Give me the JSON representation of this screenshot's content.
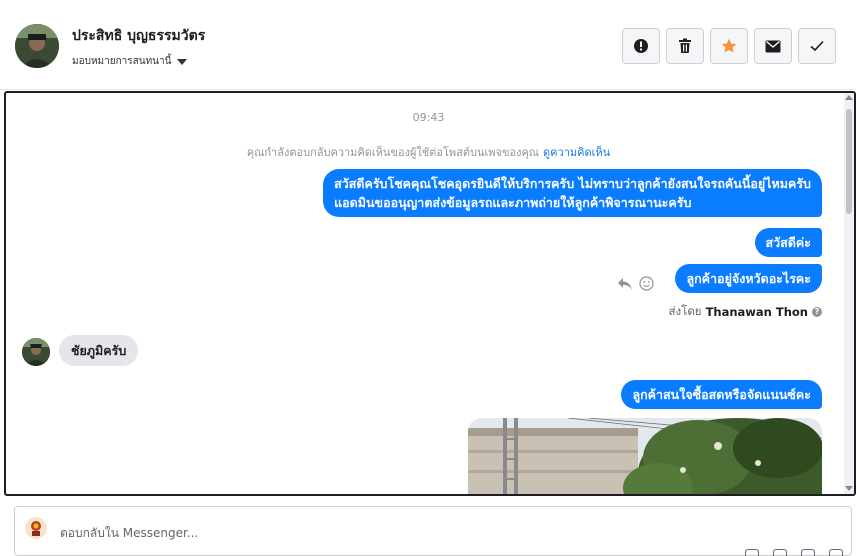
{
  "header": {
    "contact_name": "ประสิทธิ บุญธรรมวัตร",
    "assign_label": "มอบหมายการสนทนานี้",
    "actions": [
      {
        "icon": "alert-icon",
        "name": "spam-button"
      },
      {
        "icon": "trash-icon",
        "name": "delete-button"
      },
      {
        "icon": "star-icon",
        "name": "star-button",
        "color": "#f7923b"
      },
      {
        "icon": "envelope-icon",
        "name": "mark-unread-button"
      },
      {
        "icon": "checkmark-icon",
        "name": "mark-done-button"
      }
    ]
  },
  "conversation": {
    "time": "09:43",
    "notice": "คุณกำลังตอบกลับความคิดเห็นของผู้ใช้ต่อโพสต์บนเพจของคุณ",
    "notice_link": "ดูความคิดเห็น",
    "outgoing_1_line1": "สวัสดีครับโชคคุณโชคอุดรยินดีให้บริการครับ ไม่ทราบว่าลูกค้ายังสนใจรถคันนี้อยู่ไหมครับ",
    "outgoing_1_line2": "แอดมินขออนุญาตส่งข้อมูลรถและภาพถ่ายให้ลูกค้าพิจารณานะครับ",
    "outgoing_2": "สวัสดีค่ะ",
    "outgoing_3": "ลูกค้าอยู่จังหวัดอะไรคะ",
    "sent_by_label": "ส่งโดย",
    "sent_by_name": "Thanawan Thon",
    "incoming_1": "ชัยภูมิครับ",
    "outgoing_4": "ลูกค้าสนใจซื้อสดหรือจัดแนนซ์คะ"
  },
  "reply": {
    "placeholder": "ตอบกลับใน Messenger..."
  },
  "colors": {
    "bubble_out": "#0a7cff",
    "bubble_in": "#e4e6eb",
    "link": "#1876f2",
    "star": "#f7923b"
  }
}
